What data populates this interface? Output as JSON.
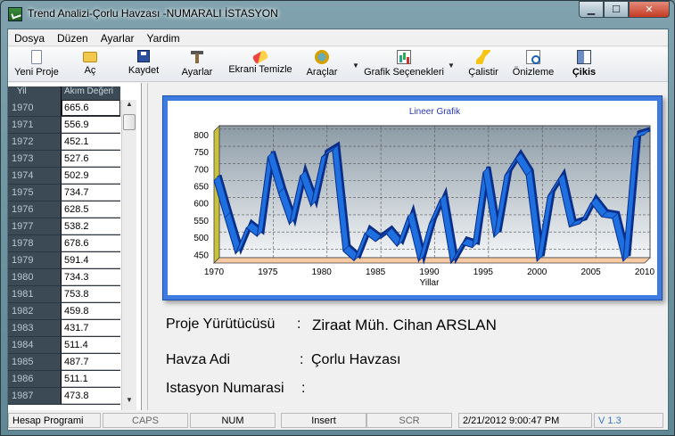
{
  "window": {
    "title": "Trend Analizi-Çorlu Havzası -NUMARALI İSTASYON",
    "minimize_glyph": "▁",
    "maximize_glyph": "☐",
    "close_glyph": "✕"
  },
  "menu": [
    "Dosya",
    "Düzen",
    "Ayarlar",
    "Yardim"
  ],
  "toolbar": {
    "new_project": "Yeni Proje",
    "open": "Aç",
    "save": "Kaydet",
    "settings": "Ayarlar",
    "clear_screen": "Ekrani Temizle",
    "tools": "Araçlar",
    "chart_options": "Grafik Seçenekleri",
    "run": "Çalistir",
    "preview": "Önizleme",
    "exit": "Çikis",
    "dropdown_glyph": "▼"
  },
  "grid": {
    "col_year": "Yil",
    "col_flow": "Akım Değeri",
    "rows": [
      {
        "year": "1970",
        "value": "665.6"
      },
      {
        "year": "1971",
        "value": "556.9"
      },
      {
        "year": "1972",
        "value": "452.1"
      },
      {
        "year": "1973",
        "value": "527.6"
      },
      {
        "year": "1974",
        "value": "502.9"
      },
      {
        "year": "1975",
        "value": "734.7"
      },
      {
        "year": "1976",
        "value": "628.5"
      },
      {
        "year": "1977",
        "value": "538.2"
      },
      {
        "year": "1978",
        "value": "678.6"
      },
      {
        "year": "1979",
        "value": "591.4"
      },
      {
        "year": "1980",
        "value": "734.3"
      },
      {
        "year": "1981",
        "value": "753.8"
      },
      {
        "year": "1982",
        "value": "459.8"
      },
      {
        "year": "1983",
        "value": "431.7"
      },
      {
        "year": "1984",
        "value": "511.4"
      },
      {
        "year": "1985",
        "value": "487.7"
      },
      {
        "year": "1986",
        "value": "511.1"
      },
      {
        "year": "1987",
        "value": "473.8"
      }
    ],
    "scroll_up_glyph": "▲",
    "scroll_down_glyph": "▼"
  },
  "chart_data": {
    "type": "line",
    "title": "Lineer Grafik",
    "xlabel": "Yillar",
    "ylabel": "",
    "x": [
      1970,
      1971,
      1972,
      1973,
      1974,
      1975,
      1976,
      1977,
      1978,
      1979,
      1980,
      1981,
      1982,
      1983,
      1984,
      1985,
      1986,
      1987,
      1988,
      1989,
      1990,
      1991,
      1992,
      1993,
      1994,
      1995,
      1996,
      1997,
      1998,
      1999,
      2000,
      2001,
      2002,
      2003,
      2004,
      2005,
      2006,
      2007,
      2008,
      2009,
      2010
    ],
    "series": [
      {
        "values": [
          665.6,
          556.9,
          452.1,
          527.6,
          502.9,
          734.7,
          628.5,
          538.2,
          678.6,
          591.4,
          734.3,
          753.8,
          459.8,
          431.7,
          511.4,
          487.7,
          511.1,
          473.8,
          560,
          430,
          540,
          610,
          425,
          480,
          470,
          690,
          500,
          680,
          730,
          680,
          430,
          620,
          670,
          530,
          540,
          600,
          560,
          555,
          430,
          790,
          800
        ]
      }
    ],
    "xlim": [
      1970,
      2010
    ],
    "ylim": [
      425,
      810
    ],
    "xticks": [
      1970,
      1975,
      1980,
      1985,
      1990,
      1995,
      2000,
      2005,
      2010
    ],
    "yticks": [
      450,
      500,
      550,
      600,
      650,
      700,
      750,
      800
    ],
    "grid": true,
    "legend": "none",
    "colors": {
      "line": "#1e6fe0",
      "line_dark": "#0a2f8a",
      "frame": "#3e7be0",
      "title": "#2a3ab8"
    }
  },
  "info": {
    "manager_label": "Proje Yürütücüsü",
    "manager_value": "Ziraat Müh. Cihan ARSLAN",
    "basin_label": "Havza Adi",
    "basin_value": "Çorlu Havzası",
    "station_label": "Istasyon Numarasi",
    "colon": ":"
  },
  "status": {
    "program": "Hesap Programi",
    "caps": "CAPS",
    "num": "NUM",
    "insert": "Insert",
    "scr": "SCR",
    "datetime": "2/21/2012 9:00:47 PM",
    "version": "V 1.3"
  }
}
